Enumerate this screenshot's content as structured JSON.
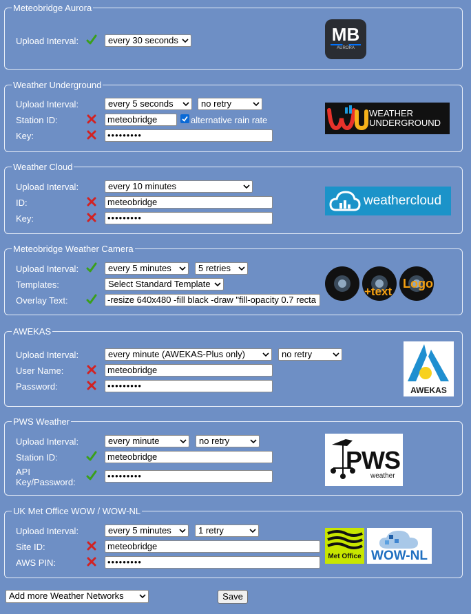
{
  "aurora": {
    "title": "Meteobridge Aurora",
    "upload_label": "Upload Interval:",
    "upload_value": "every 30 seconds",
    "upload_status_icon": "check-icon",
    "logo": {
      "big": "MB",
      "small": "AURORA"
    }
  },
  "wunderground": {
    "title": "Weather Underground",
    "upload_label": "Upload Interval:",
    "upload_value": "every 5 seconds",
    "retry_value": "no retry",
    "station_label": "Station ID:",
    "station_value": "meteobridge",
    "station_status_icon": "cross-icon",
    "alt_rain_label": "alternative rain rate",
    "alt_rain_checked": true,
    "key_label": "Key:",
    "key_value": "•••••••••",
    "key_status_icon": "cross-icon",
    "logo": {
      "line1": "WEATHER",
      "line2": "UNDERGROUND",
      "mark": "wu"
    }
  },
  "weathercloud": {
    "title": "Weather Cloud",
    "upload_label": "Upload Interval:",
    "upload_value": "every 10 minutes",
    "id_label": "ID:",
    "id_value": "meteobridge",
    "id_status_icon": "cross-icon",
    "key_label": "Key:",
    "key_value": "•••••••••",
    "key_status_icon": "cross-icon",
    "logo": {
      "text": "weathercloud"
    }
  },
  "camera": {
    "title": "Meteobridge Weather Camera",
    "upload_label": "Upload Interval:",
    "upload_value": "every 5 minutes",
    "upload_status_icon": "check-icon",
    "retry_value": "5 retries",
    "templates_label": "Templates:",
    "templates_value": "Select Standard Template",
    "overlay_label": "Overlay Text:",
    "overlay_value": "-resize 640x480 -fill black -draw \"fill-opacity 0.7 recta",
    "overlay_status_icon": "check-icon",
    "logo": {
      "plus_text": "+text",
      "logo_text": "Logo"
    }
  },
  "awekas": {
    "title": "AWEKAS",
    "upload_label": "Upload Interval:",
    "upload_value": "every minute (AWEKAS-Plus only)",
    "retry_value": "no retry",
    "user_label": "User Name:",
    "user_value": "meteobridge",
    "user_status_icon": "cross-icon",
    "password_label": "Password:",
    "password_value": "•••••••••",
    "password_status_icon": "cross-icon",
    "logo": {
      "text": "AWEKAS"
    }
  },
  "pws": {
    "title": "PWS Weather",
    "upload_label": "Upload Interval:",
    "upload_value": "every minute",
    "retry_value": "no retry",
    "station_label": "Station ID:",
    "station_value": "meteobridge",
    "station_status_icon": "check-icon",
    "api_label_1": "API",
    "api_label_2": "Key/Password:",
    "api_value": "•••••••••",
    "api_status_icon": "check-icon",
    "logo": {
      "big": "PWS",
      "small": "weather"
    }
  },
  "metoffice": {
    "title": "UK Met Office WOW / WOW-NL",
    "upload_label": "Upload Interval:",
    "upload_value": "every 5 minutes",
    "retry_value": "1 retry",
    "site_label": "Site ID:",
    "site_value": "meteobridge",
    "site_status_icon": "cross-icon",
    "pin_label": "AWS PIN:",
    "pin_value": "•••••••••",
    "pin_status_icon": "cross-icon",
    "logo": {
      "metoffice": "Met Office",
      "wow": "WOW-NL"
    }
  },
  "footer": {
    "add_networks": "Add more Weather Networks",
    "save": "Save"
  },
  "colors": {
    "page_bg": "#6e8fc5",
    "check": "#3aa01a",
    "cross": "#d22222",
    "weathercloud": "#1b93c9"
  }
}
